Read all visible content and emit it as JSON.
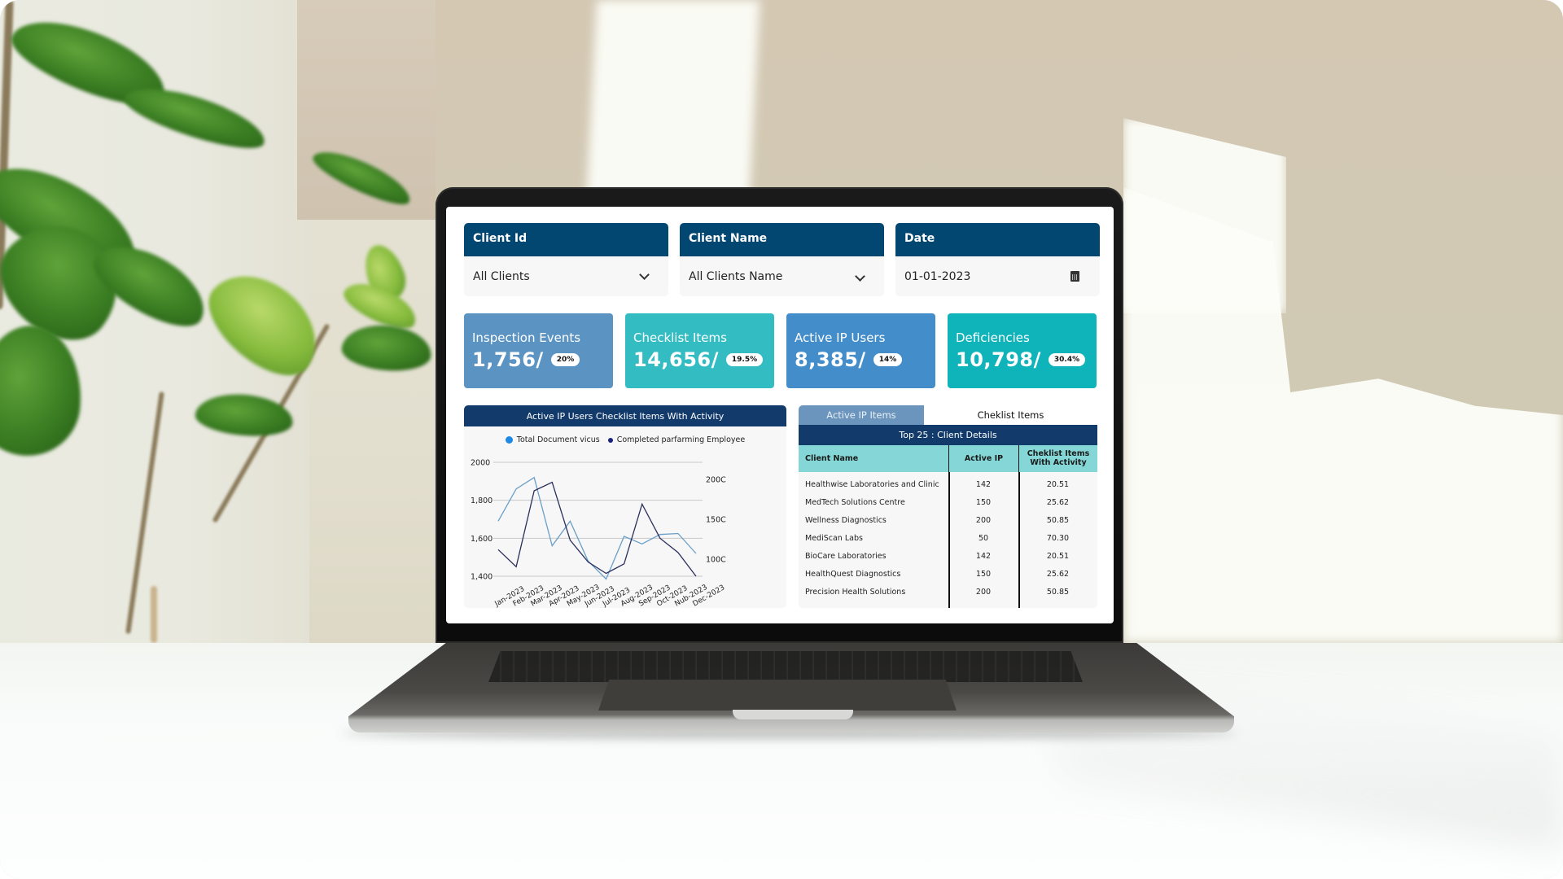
{
  "filters": [
    {
      "label": "Client Id",
      "value": "All Clients",
      "icon": "chevron-down-icon"
    },
    {
      "label": "Client Name",
      "value": "All Clients Name",
      "icon": "chevron-down-icon"
    },
    {
      "label": "Date",
      "value": "01-01-2023",
      "icon": "calendar-icon"
    }
  ],
  "kpis": [
    {
      "label": "Inspection Events",
      "value": "1,756/",
      "badge": "20%",
      "color": "#5b94c3"
    },
    {
      "label": "Checklist Items",
      "value": "14,656/",
      "badge": "19.5%",
      "color": "#34bcc3"
    },
    {
      "label": "Active IP Users",
      "value": "8,385/",
      "badge": "14%",
      "color": "#438dcb"
    },
    {
      "label": "Deficiencies",
      "value": "10,798/",
      "badge": "30.4%",
      "color": "#0fb3ba"
    }
  ],
  "chart_data": {
    "type": "line",
    "title": "Active IP Users Checklist Items With Activity",
    "xlabel": "",
    "ylabel": "",
    "categories": [
      "Jan-2023",
      "Feb-2023",
      "Mar-2023",
      "Apr-2023",
      "May-2023",
      "Jun-2023",
      "Jul-2023",
      "Aug-2023",
      "Sep-2023",
      "Oct-2023",
      "Nub-2023",
      "Dec-2023"
    ],
    "series": [
      {
        "name": "Total Document vicus",
        "color": "#6a9fc8",
        "legend_color": "#1e88e5",
        "values": [
          1690,
          1860,
          1920,
          1560,
          1690,
          1480,
          1385,
          1610,
          1570,
          1620,
          1625,
          1520
        ]
      },
      {
        "name": "Completed parfarming Employee",
        "color": "#2b2f5e",
        "legend_color": "#1a237e",
        "values": [
          1540,
          1450,
          1850,
          1895,
          1590,
          1475,
          1415,
          1465,
          1780,
          1600,
          1525,
          1400
        ]
      }
    ],
    "ylim": [
      1400,
      2000
    ],
    "yticks": [
      "2000",
      "1,800",
      "1,600",
      "1,400"
    ],
    "ytick_values": [
      2000,
      1800,
      1600,
      1400
    ],
    "secondary_yticks": [
      "200C",
      "150C",
      "100C"
    ],
    "secondary_ytick_positions_in_primary_units": [
      1910,
      1700,
      1490
    ],
    "grid": true,
    "legend": "top-center"
  },
  "table": {
    "tabs": [
      {
        "label": "Active IP Items",
        "active": true
      },
      {
        "label": "Cheklist Items",
        "active": false
      }
    ],
    "title": "Top 25 : Client Details",
    "columns": [
      "Client Name",
      "Active IP",
      "Cheklist Items With Activity"
    ],
    "rows": [
      [
        "Healthwise Laboratories and Clinic",
        "142",
        "20.51"
      ],
      [
        "MedTech Solutions Centre",
        "150",
        "25.62"
      ],
      [
        "Wellness Diagnostics",
        "200",
        "50.85"
      ],
      [
        "MediScan Labs",
        "50",
        "70.30"
      ],
      [
        "BioCare Laboratories",
        "142",
        "20.51"
      ],
      [
        "HealthQuest Diagnostics",
        "150",
        "25.62"
      ],
      [
        "Precision Health Solutions",
        "200",
        "50.85"
      ]
    ]
  }
}
